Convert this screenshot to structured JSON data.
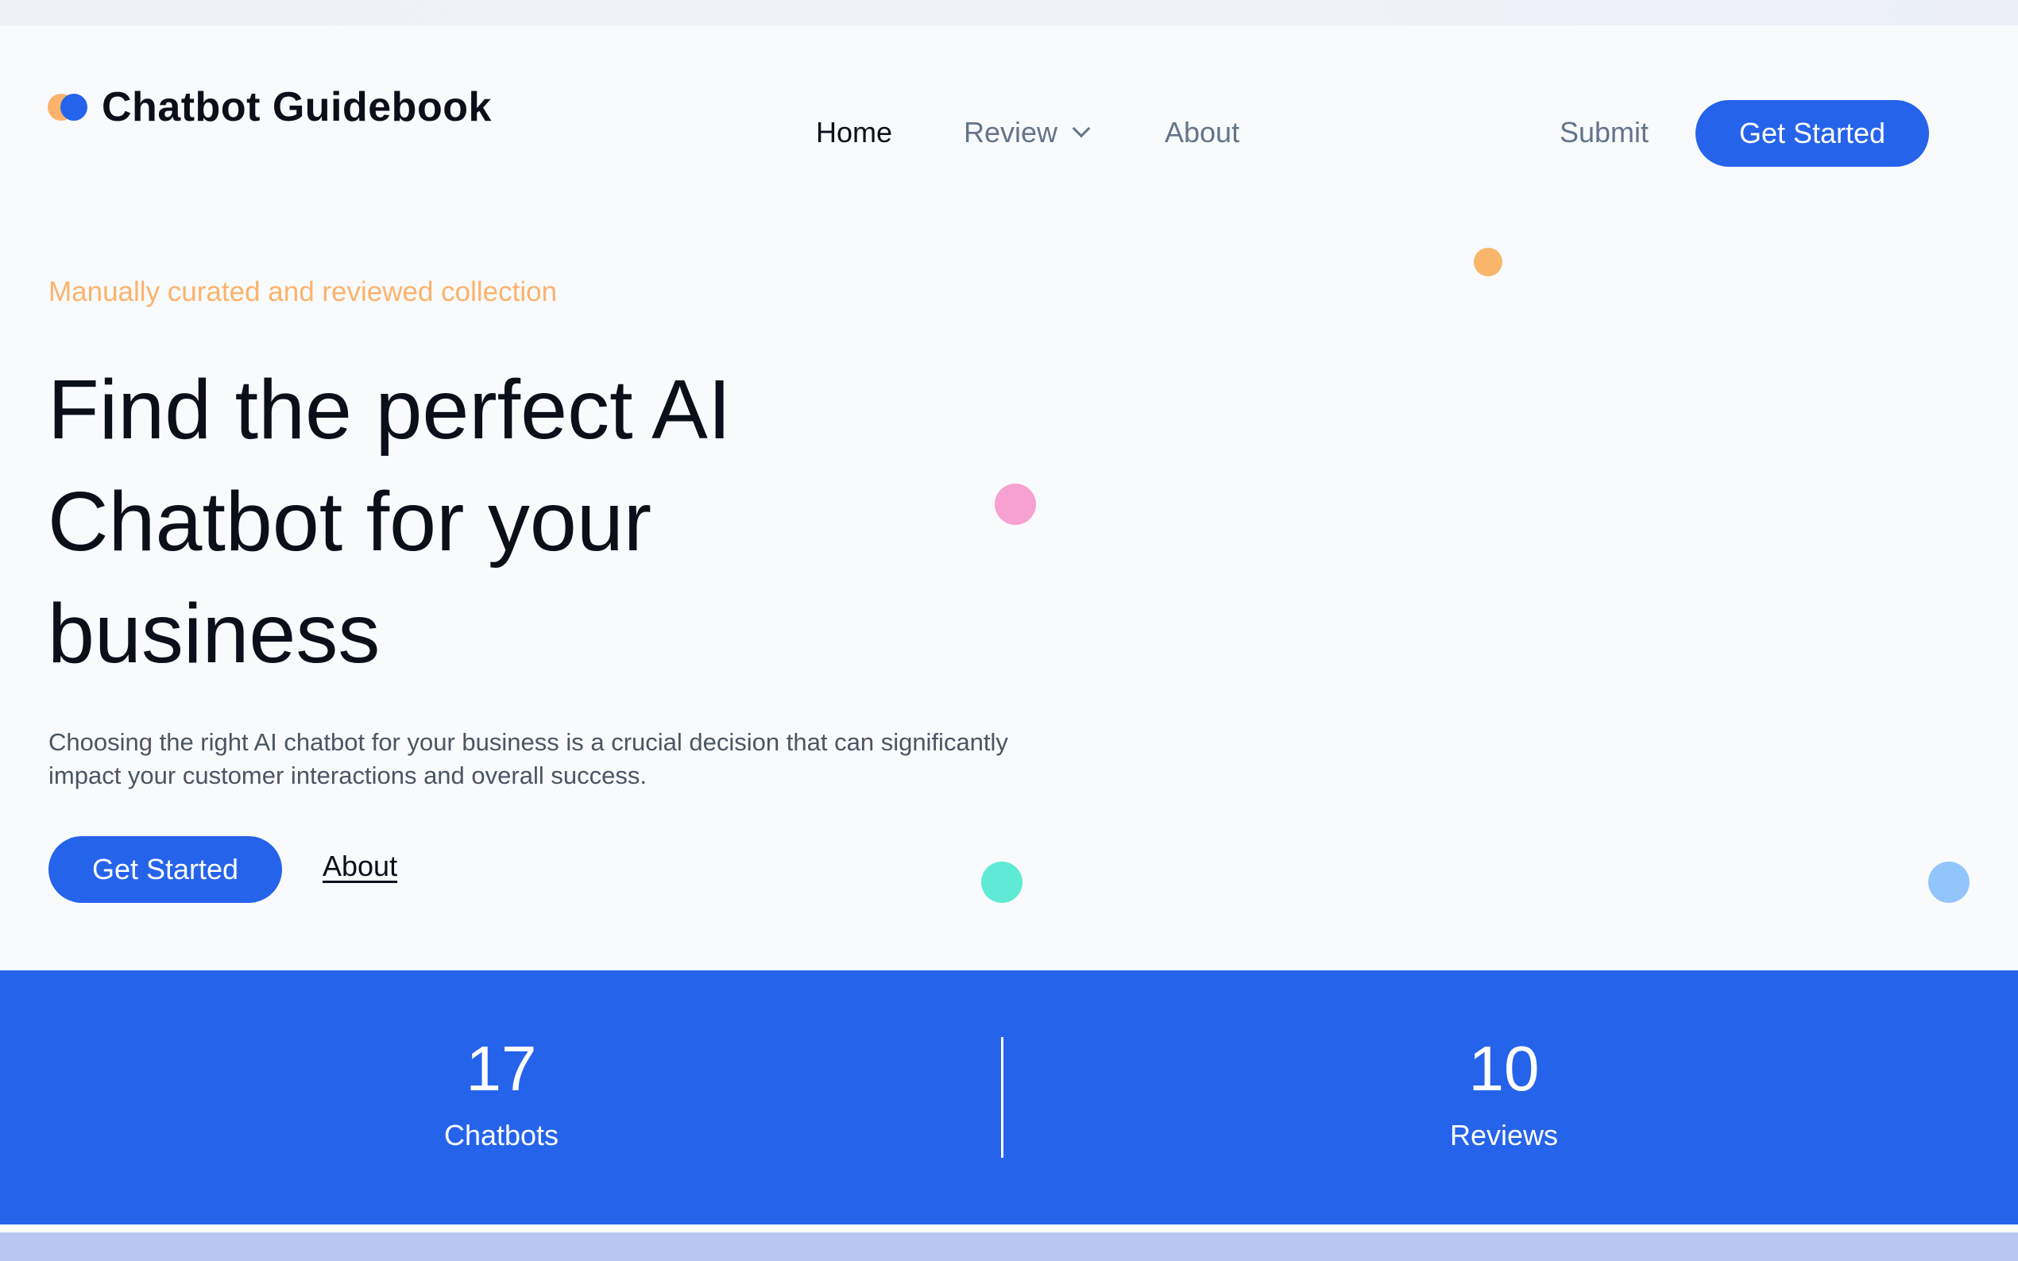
{
  "brand": {
    "name": "Chatbot Guidebook",
    "logo_icon": "two-dots-logo-icon",
    "logo_colors": [
      "#fbb36b",
      "#2563eb"
    ]
  },
  "nav": {
    "home": "Home",
    "review": "Review",
    "about": "About",
    "submit": "Submit",
    "get_started": "Get Started"
  },
  "hero": {
    "eyebrow": "Manually curated and reviewed collection",
    "title": "Find the perfect AI Chatbot for your business",
    "description": "Choosing the right AI chatbot for your business is a crucial decision that can significantly impact your customer interactions and overall success.",
    "cta_primary": "Get Started",
    "cta_secondary": "About"
  },
  "stats": [
    {
      "value": "17",
      "label": "Chatbots"
    },
    {
      "value": "10",
      "label": "Reviews"
    }
  ],
  "colors": {
    "accent": "#2563eb",
    "eyebrow": "#fbb36b",
    "deco_orange": "#f9b56a",
    "deco_pink": "#f7a1d0",
    "deco_teal": "#5eead4",
    "deco_blue": "#93c5fd",
    "bottom_strip": "#bac6f1"
  }
}
